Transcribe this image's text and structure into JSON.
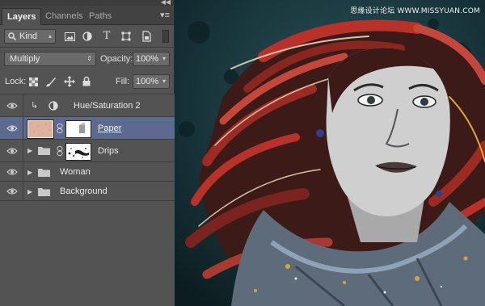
{
  "watermark": "思缘设计论坛 WWW.MISSYUAN.COM",
  "panel": {
    "tabs": [
      {
        "label": "Layers",
        "active": true
      },
      {
        "label": "Channels",
        "active": false
      },
      {
        "label": "Paths",
        "active": false
      }
    ],
    "filter": {
      "label": "Kind"
    },
    "blend_mode": "Multiply",
    "opacity": {
      "label": "Opacity:",
      "value": "100%"
    },
    "lock": {
      "label": "Lock:"
    },
    "fill": {
      "label": "Fill:",
      "value": "100%"
    },
    "layers": [
      {
        "name": "Hue/Saturation 2",
        "type": "adjustment",
        "visible": true,
        "clipped": true
      },
      {
        "name": "Paper",
        "type": "layer-with-mask",
        "visible": true,
        "selected": true
      },
      {
        "name": "Drips",
        "type": "group-with-mask",
        "visible": true
      },
      {
        "name": "Woman",
        "type": "group",
        "visible": true
      },
      {
        "name": "Background",
        "type": "group",
        "visible": true
      }
    ]
  },
  "colors": {
    "panel_bg": "#535353",
    "selection": "#5b6a8e",
    "canvas_bg": "#17343a",
    "hair_red": "#b8322a",
    "skin": "#cfcfcf"
  }
}
